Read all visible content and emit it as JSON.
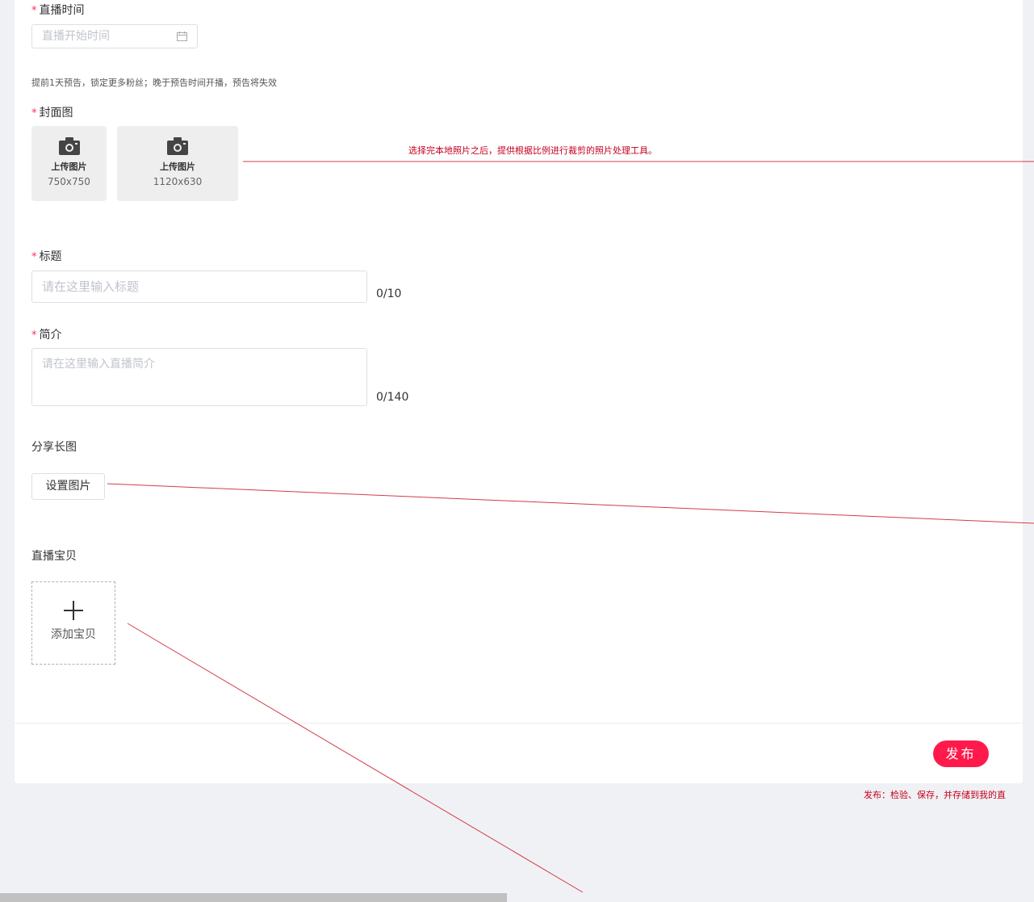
{
  "form": {
    "live_time": {
      "label": "直播时间",
      "required_mark": "*",
      "placeholder": "直播开始时间",
      "hint": "提前1天预告，锁定更多粉丝；晚于预告时间开播，预告将失效"
    },
    "cover": {
      "label": "封面图",
      "required_mark": "*",
      "uploads": [
        {
          "label": "上传图片",
          "size": "750x750"
        },
        {
          "label": "上传图片",
          "size": "1120x630"
        }
      ]
    },
    "title": {
      "label": "标题",
      "required_mark": "*",
      "placeholder": "请在这里输入标题",
      "counter": "0/10"
    },
    "intro": {
      "label": "简介",
      "required_mark": "*",
      "placeholder": "请在这里输入直播简介",
      "counter": "0/140"
    },
    "share_image": {
      "label": "分享长图",
      "button": "设置图片"
    },
    "products": {
      "label": "直播宝贝",
      "add_label": "添加宝贝"
    },
    "publish_button": "发布"
  },
  "annotations": {
    "cover_note": "选择完本地照片之后，提供根据比例进行裁剪的照片处理工具。",
    "publish_note": "发布：检验、保存，并存储到我的直"
  },
  "colors": {
    "accent": "#ff1a4b",
    "annotation": "#c4001e",
    "background": "#f0f1f4"
  },
  "icons": {
    "calendar": "calendar-icon",
    "camera": "camera-icon",
    "plus": "plus-icon"
  }
}
